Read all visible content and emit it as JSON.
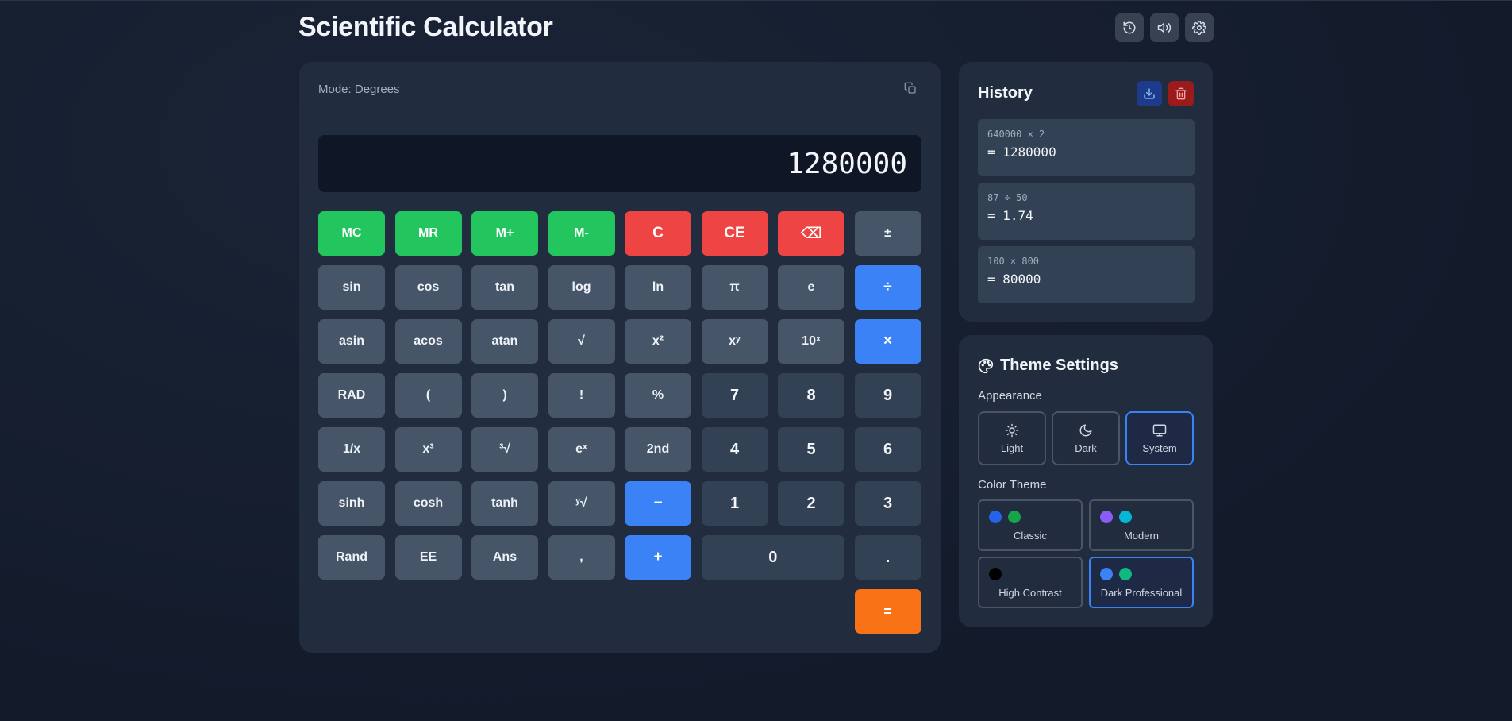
{
  "header": {
    "title": "Scientific Calculator",
    "actions": [
      {
        "icon": "history-icon"
      },
      {
        "icon": "volume-icon"
      },
      {
        "icon": "settings-icon"
      }
    ]
  },
  "calculator": {
    "mode_label": "Mode: Degrees",
    "display_value": "1280000",
    "copy_icon": "copy-icon",
    "keys": [
      {
        "label": "MC",
        "type": "mem",
        "name": "mc-key"
      },
      {
        "label": "MR",
        "type": "mem",
        "name": "mr-key"
      },
      {
        "label": "M+",
        "type": "mem",
        "name": "m-plus-key"
      },
      {
        "label": "M-",
        "type": "mem",
        "name": "m-minus-key"
      },
      {
        "label": "C",
        "type": "clr",
        "name": "clear-key"
      },
      {
        "label": "CE",
        "type": "clr",
        "name": "clear-entry-key"
      },
      {
        "label": "⌫",
        "type": "clr",
        "name": "backspace-key"
      },
      {
        "label": "±",
        "type": "fn",
        "name": "sign-toggle-key"
      },
      {
        "label": "sin",
        "type": "fn",
        "name": "sin-key"
      },
      {
        "label": "cos",
        "type": "fn",
        "name": "cos-key"
      },
      {
        "label": "tan",
        "type": "fn",
        "name": "tan-key"
      },
      {
        "label": "log",
        "type": "fn",
        "name": "log-key"
      },
      {
        "label": "ln",
        "type": "fn",
        "name": "ln-key"
      },
      {
        "label": "π",
        "type": "fn",
        "name": "pi-key"
      },
      {
        "label": "e",
        "type": "fn",
        "name": "e-key"
      },
      {
        "label": "÷",
        "type": "op",
        "name": "divide-key"
      },
      {
        "label": "asin",
        "type": "fn",
        "name": "asin-key"
      },
      {
        "label": "acos",
        "type": "fn",
        "name": "acos-key"
      },
      {
        "label": "atan",
        "type": "fn",
        "name": "atan-key"
      },
      {
        "label": "√",
        "type": "fn",
        "name": "sqrt-key"
      },
      {
        "label": "x²",
        "type": "fn",
        "name": "square-key"
      },
      {
        "label": "xʸ",
        "type": "fn",
        "name": "power-key"
      },
      {
        "label": "10ˣ",
        "type": "fn",
        "name": "ten-power-key"
      },
      {
        "label": "×",
        "type": "op",
        "name": "multiply-key"
      },
      {
        "label": "RAD",
        "type": "fn",
        "name": "rad-key"
      },
      {
        "label": "(",
        "type": "fn",
        "name": "open-paren-key"
      },
      {
        "label": ")",
        "type": "fn",
        "name": "close-paren-key"
      },
      {
        "label": "!",
        "type": "fn",
        "name": "factorial-key"
      },
      {
        "label": "%",
        "type": "fn",
        "name": "percent-key"
      },
      {
        "label": "7",
        "type": "num",
        "name": "digit-7-key"
      },
      {
        "label": "8",
        "type": "num",
        "name": "digit-8-key"
      },
      {
        "label": "9",
        "type": "num",
        "name": "digit-9-key"
      },
      {
        "label": "1/x",
        "type": "fn",
        "name": "reciprocal-key"
      },
      {
        "label": "x³",
        "type": "fn",
        "name": "cube-key"
      },
      {
        "label": "³√",
        "type": "fn",
        "name": "cube-root-key"
      },
      {
        "label": "eˣ",
        "type": "fn",
        "name": "exp-key"
      },
      {
        "label": "2nd",
        "type": "fn",
        "name": "second-key"
      },
      {
        "label": "4",
        "type": "num",
        "name": "digit-4-key"
      },
      {
        "label": "5",
        "type": "num",
        "name": "digit-5-key"
      },
      {
        "label": "6",
        "type": "num",
        "name": "digit-6-key"
      },
      {
        "label": "sinh",
        "type": "fn",
        "name": "sinh-key"
      },
      {
        "label": "cosh",
        "type": "fn",
        "name": "cosh-key"
      },
      {
        "label": "tanh",
        "type": "fn",
        "name": "tanh-key"
      },
      {
        "label": "ʸ√",
        "type": "fn",
        "name": "nth-root-key"
      },
      {
        "label": "−",
        "type": "op",
        "name": "subtract-key"
      },
      {
        "label": "1",
        "type": "num",
        "name": "digit-1-key"
      },
      {
        "label": "2",
        "type": "num",
        "name": "digit-2-key"
      },
      {
        "label": "3",
        "type": "num",
        "name": "digit-3-key"
      },
      {
        "label": "Rand",
        "type": "fn",
        "name": "rand-key"
      },
      {
        "label": "EE",
        "type": "fn",
        "name": "ee-key"
      },
      {
        "label": "Ans",
        "type": "fn",
        "name": "ans-key"
      },
      {
        "label": ",",
        "type": "fn",
        "name": "comma-key"
      },
      {
        "label": "+",
        "type": "op",
        "name": "add-key"
      },
      {
        "label": "0",
        "type": "num zero",
        "name": "digit-0-key"
      },
      {
        "label": ".",
        "type": "num",
        "name": "decimal-key"
      },
      {
        "label": "=",
        "type": "eq eq-pos",
        "name": "equals-key"
      }
    ]
  },
  "history": {
    "title": "History",
    "items": [
      {
        "expression": "640000 × 2",
        "result": "= 1280000"
      },
      {
        "expression": "87 ÷ 50",
        "result": "= 1.74"
      },
      {
        "expression": "100 × 800",
        "result": "= 80000"
      }
    ]
  },
  "theme": {
    "title": "Theme Settings",
    "appearance_label": "Appearance",
    "appearance_options": [
      {
        "label": "Light",
        "icon": "sun-icon",
        "active": false
      },
      {
        "label": "Dark",
        "icon": "moon-icon",
        "active": false
      },
      {
        "label": "System",
        "icon": "monitor-icon",
        "active": true
      }
    ],
    "color_label": "Color Theme",
    "color_options": [
      {
        "label": "Classic",
        "colors": [
          "#2563eb",
          "#16a34a"
        ],
        "active": false
      },
      {
        "label": "Modern",
        "colors": [
          "#8b5cf6",
          "#06b6d4"
        ],
        "active": false
      },
      {
        "label": "High Contrast",
        "colors": [
          "#000000"
        ],
        "active": false
      },
      {
        "label": "Dark Professional",
        "colors": [
          "#3b82f6",
          "#10b981"
        ],
        "active": true
      }
    ]
  },
  "colors": {
    "background": "#141d2e",
    "panel": "#212c3e",
    "memory_key": "#22c55e",
    "clear_key": "#ef4444",
    "operator_key": "#3b82f6",
    "equals_key": "#f97316"
  }
}
